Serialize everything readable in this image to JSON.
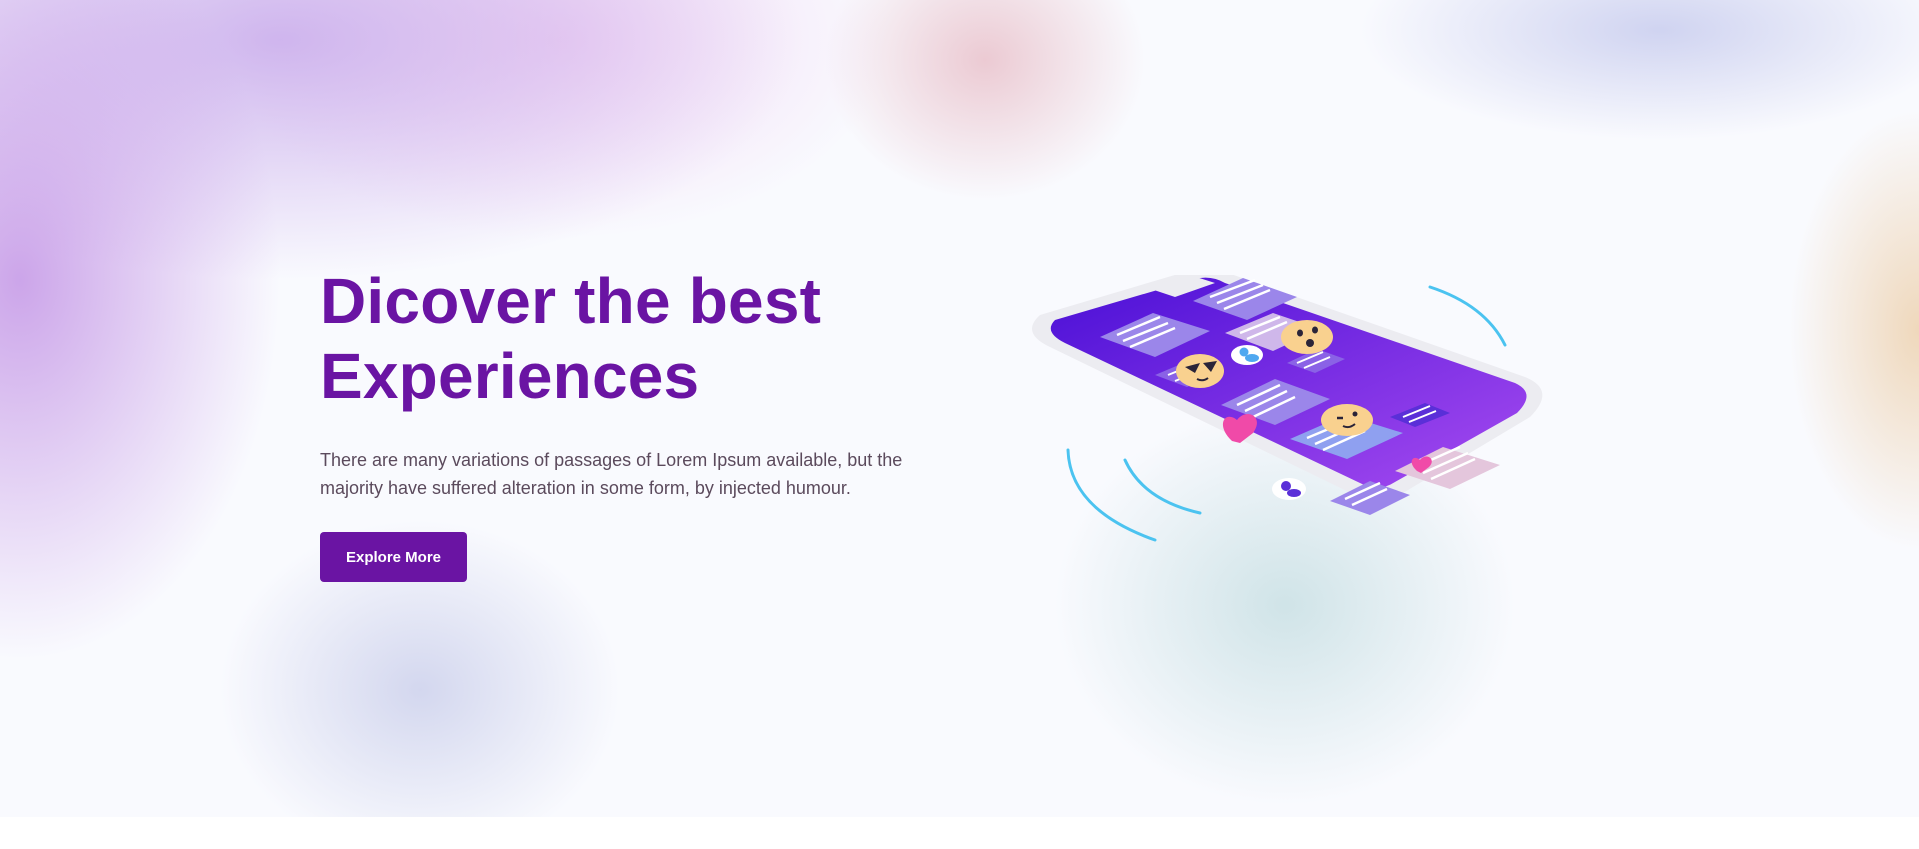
{
  "hero": {
    "title_line1": "Dicover the best",
    "title_line2": "Experiences",
    "description": "There are many variations of passages of Lorem Ipsum available, but the majority have suffered alteration in some form, by injected humour.",
    "cta_label": "Explore More"
  },
  "illustration": {
    "icon": "phone-chat-illustration"
  },
  "colors": {
    "brand": "#6a14a3",
    "body_text": "#5b4a5c",
    "background": "#f9fafe",
    "phone_screen": "#6a1fe0",
    "accent_pink": "#f04aa8",
    "wave_blue": "#4bc3f0"
  }
}
